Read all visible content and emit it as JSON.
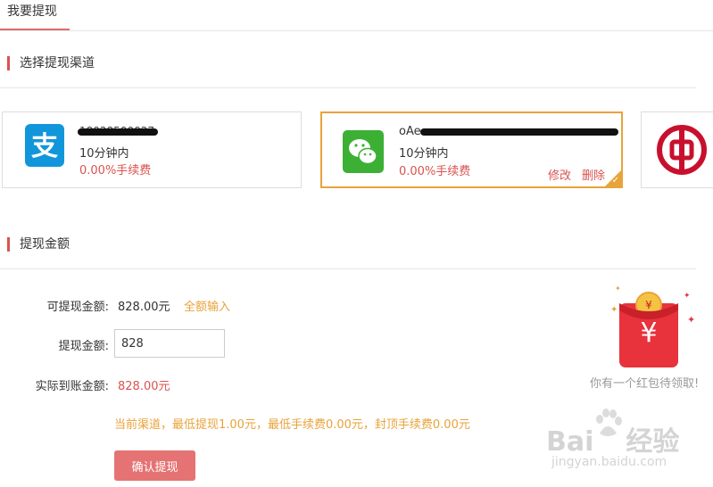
{
  "tab": {
    "label": "我要提现"
  },
  "channel_section": {
    "title": "选择提现渠道"
  },
  "channels": [
    {
      "type": "alipay",
      "icon": "alipay-icon",
      "account": "18028500027",
      "eta": "10分钟内",
      "fee": "0.00%手续费",
      "selected": false
    },
    {
      "type": "wechat",
      "icon": "wechat-icon",
      "account": "oAe",
      "eta": "10分钟内",
      "fee": "0.00%手续费",
      "selected": true,
      "edit_label": "修改",
      "delete_label": "删除"
    },
    {
      "type": "bank",
      "icon": "bank-of-china-icon",
      "selected": false
    }
  ],
  "amount_section": {
    "title": "提现金额"
  },
  "form": {
    "available_label": "可提现金额:",
    "available_value": "828.00元",
    "fill_all_label": "全额输入",
    "amount_label": "提现金额:",
    "amount_value": "828",
    "actual_label": "实际到账金额:",
    "actual_value": "828.00元",
    "notice": "当前渠道，最低提现1.00元，最低手续费0.00元，封顶手续费0.00元",
    "submit_label": "确认提现"
  },
  "redpacket": {
    "symbol": "¥",
    "caption": "你有一个红包待领取!",
    "icon": "red-packet-icon"
  },
  "watermark": {
    "brand": "Bai",
    "brand_suffix": "经验",
    "url": "jingyan.baidu.com",
    "icon": "baidu-paw-icon"
  },
  "colors": {
    "accent_red": "#d9534f",
    "accent_orange": "#e8a33a",
    "button": "#e57373",
    "alipay": "#1296db",
    "wechat": "#3cb034"
  }
}
